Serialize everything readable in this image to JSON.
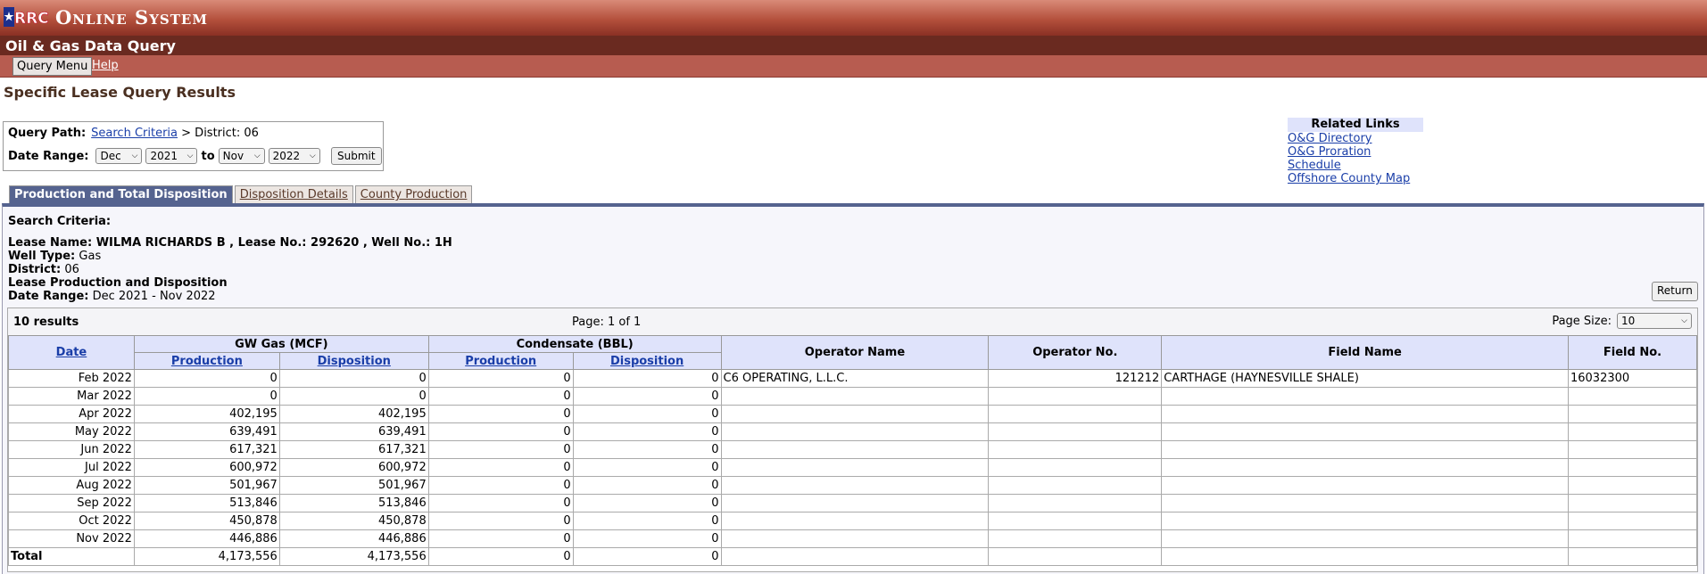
{
  "header": {
    "logo_text": "RRC",
    "system_title": "Online System",
    "app_title": "Oil & Gas Data Query",
    "menu": {
      "query_menu": "Query Menu",
      "help": "Help"
    }
  },
  "page_title": "Specific Lease Query Results",
  "query": {
    "path_label": "Query Path:",
    "path_link": "Search Criteria",
    "path_rest": "> District: 06",
    "date_label": "Date Range:",
    "from_month": "Dec",
    "from_year": "2021",
    "to_label": "to",
    "to_month": "Nov",
    "to_year": "2022",
    "submit": "Submit"
  },
  "related": {
    "heading": "Related Links",
    "links": [
      "O&G Directory",
      "O&G Proration Schedule",
      "Offshore County Map"
    ]
  },
  "tabs": [
    "Production and Total Disposition",
    "Disposition Details",
    "County Production"
  ],
  "criteria": {
    "heading": "Search Criteria:",
    "lease_line": "Lease Name: WILMA RICHARDS B , Lease No.: 292620 , Well No.: 1H",
    "well_type_label": "Well Type:",
    "well_type": "Gas",
    "district_label": "District:",
    "district": "06",
    "section": "Lease Production and Disposition",
    "date_range_label": "Date Range:",
    "date_range": "Dec 2021 - Nov 2022",
    "return": "Return"
  },
  "results": {
    "count": "10 results",
    "page": "Page: 1 of 1",
    "page_size_label": "Page Size:",
    "page_size": "10"
  },
  "table": {
    "headers": {
      "date": "Date",
      "gw_gas": "GW Gas (MCF)",
      "condensate": "Condensate (BBL)",
      "production": "Production",
      "disposition": "Disposition",
      "operator_name": "Operator Name",
      "operator_no": "Operator No.",
      "field_name": "Field Name",
      "field_no": "Field No."
    },
    "rows": [
      {
        "date": "Feb 2022",
        "gas_prod": "0",
        "gas_disp": "0",
        "cond_prod": "0",
        "cond_disp": "0",
        "operator": "C6 OPERATING, L.L.C.",
        "operator_no": "121212",
        "field": "CARTHAGE (HAYNESVILLE SHALE)",
        "field_no": "16032300"
      },
      {
        "date": "Mar 2022",
        "gas_prod": "0",
        "gas_disp": "0",
        "cond_prod": "0",
        "cond_disp": "0",
        "operator": "",
        "operator_no": "",
        "field": "",
        "field_no": ""
      },
      {
        "date": "Apr 2022",
        "gas_prod": "402,195",
        "gas_disp": "402,195",
        "cond_prod": "0",
        "cond_disp": "0",
        "operator": "",
        "operator_no": "",
        "field": "",
        "field_no": ""
      },
      {
        "date": "May 2022",
        "gas_prod": "639,491",
        "gas_disp": "639,491",
        "cond_prod": "0",
        "cond_disp": "0",
        "operator": "",
        "operator_no": "",
        "field": "",
        "field_no": ""
      },
      {
        "date": "Jun 2022",
        "gas_prod": "617,321",
        "gas_disp": "617,321",
        "cond_prod": "0",
        "cond_disp": "0",
        "operator": "",
        "operator_no": "",
        "field": "",
        "field_no": ""
      },
      {
        "date": "Jul 2022",
        "gas_prod": "600,972",
        "gas_disp": "600,972",
        "cond_prod": "0",
        "cond_disp": "0",
        "operator": "",
        "operator_no": "",
        "field": "",
        "field_no": ""
      },
      {
        "date": "Aug 2022",
        "gas_prod": "501,967",
        "gas_disp": "501,967",
        "cond_prod": "0",
        "cond_disp": "0",
        "operator": "",
        "operator_no": "",
        "field": "",
        "field_no": ""
      },
      {
        "date": "Sep 2022",
        "gas_prod": "513,846",
        "gas_disp": "513,846",
        "cond_prod": "0",
        "cond_disp": "0",
        "operator": "",
        "operator_no": "",
        "field": "",
        "field_no": ""
      },
      {
        "date": "Oct 2022",
        "gas_prod": "450,878",
        "gas_disp": "450,878",
        "cond_prod": "0",
        "cond_disp": "0",
        "operator": "",
        "operator_no": "",
        "field": "",
        "field_no": ""
      },
      {
        "date": "Nov 2022",
        "gas_prod": "446,886",
        "gas_disp": "446,886",
        "cond_prod": "0",
        "cond_disp": "0",
        "operator": "",
        "operator_no": "",
        "field": "",
        "field_no": ""
      }
    ],
    "total": {
      "label": "Total",
      "gas_prod": "4,173,556",
      "gas_disp": "4,173,556",
      "cond_prod": "0",
      "cond_disp": "0"
    }
  }
}
